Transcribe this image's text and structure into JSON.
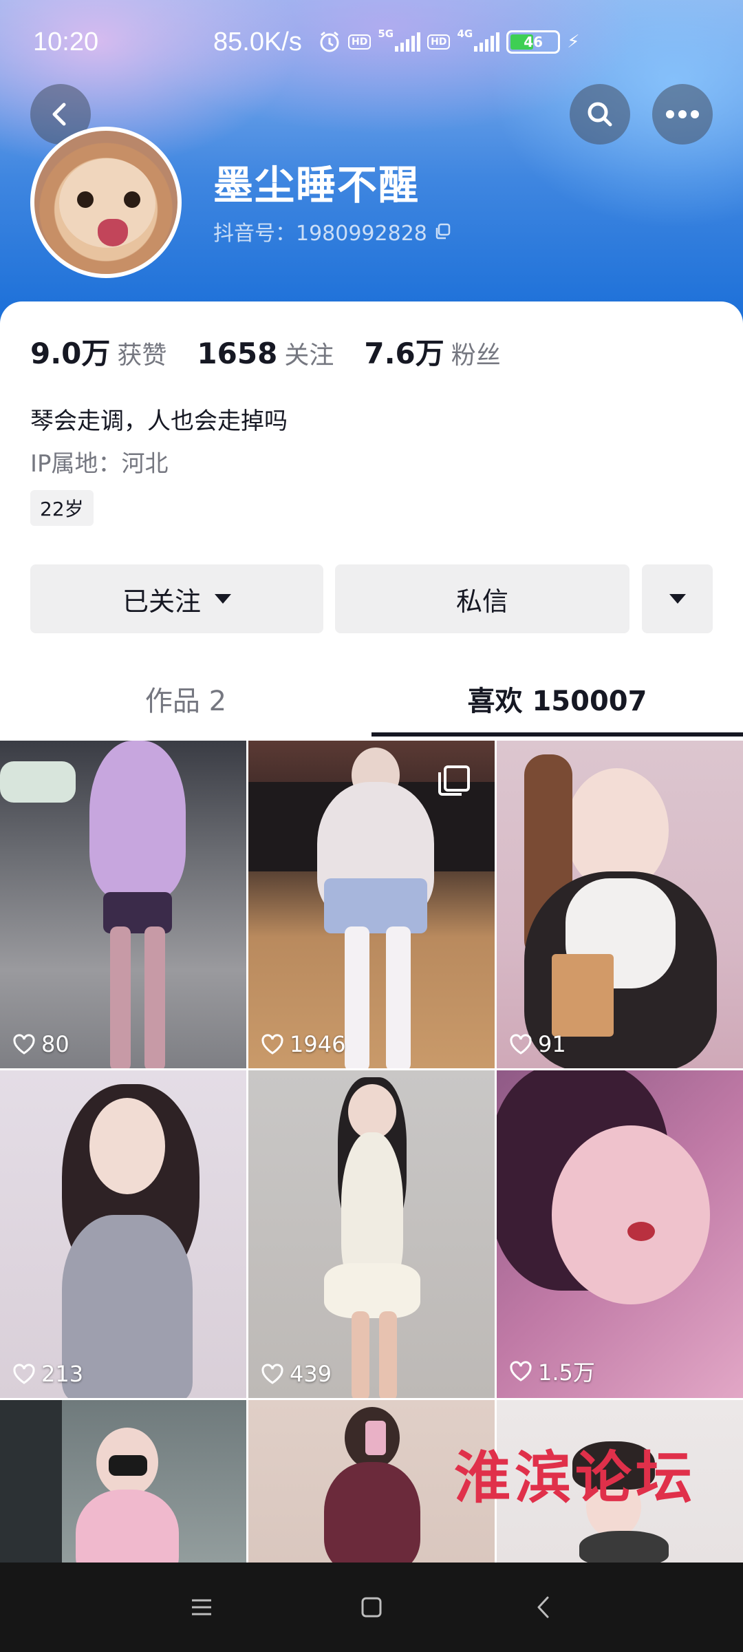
{
  "status_bar": {
    "time": "10:20",
    "net_speed": "85.0K/s",
    "network_1": "5G",
    "network_2": "4G",
    "hd_1": "HD",
    "hd_2": "HD",
    "battery": "46"
  },
  "profile": {
    "username": "墨尘睡不醒",
    "douyin_id": "抖音号：1980992828",
    "bio": "琴会走调，人也会走掉吗",
    "ip_location": "IP属地：河北",
    "age_tag": "22岁"
  },
  "stats": [
    {
      "value": "9.0万",
      "label": "获赞"
    },
    {
      "value": "1658",
      "label": "关注"
    },
    {
      "value": "7.6万",
      "label": "粉丝"
    }
  ],
  "actions": {
    "follow_label": "已关注",
    "message_label": "私信"
  },
  "tabs": {
    "works": "作品 2",
    "likes": "喜欢 150007",
    "active": "likes"
  },
  "grid_items": [
    {
      "likes": "80"
    },
    {
      "likes": "1946"
    },
    {
      "likes": "91"
    },
    {
      "likes": "213"
    },
    {
      "likes": "439"
    },
    {
      "likes": "1.5万"
    }
  ],
  "watermark": "淮滨论坛",
  "icons": [
    "back-icon",
    "search-icon",
    "more-icon",
    "copy-icon",
    "heart-icon",
    "multi-image-icon",
    "caret-down-icon",
    "menu-icon",
    "home-icon",
    "nav-back-icon"
  ],
  "colors": {
    "header_blue": "#1b6fd8",
    "text_primary": "#161823",
    "text_secondary": "#757780",
    "button_bg": "#efeff0"
  }
}
